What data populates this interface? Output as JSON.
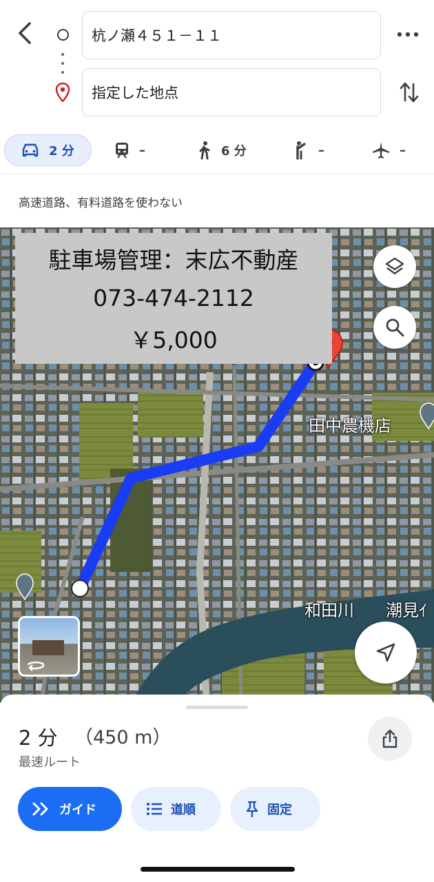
{
  "search": {
    "origin": "杭ノ瀬４５１－１１",
    "destination": "指定した地点"
  },
  "icons": {
    "back": "arrow-back-icon",
    "origin": "origin-circle-icon",
    "destination": "location-pin-icon",
    "more": "more-horizontal-icon",
    "swap": "swap-vertical-icon",
    "car": "car-icon",
    "transit": "train-icon",
    "walk": "walk-icon",
    "ride": "ride-hail-icon",
    "flight": "airplane-icon",
    "layers": "layers-icon",
    "search": "search-icon",
    "locate": "navigation-arrow-icon",
    "share": "share-icon",
    "guide": "double-chevron-icon",
    "steps": "list-icon",
    "pin": "pushpin-icon"
  },
  "modes": {
    "drive": "2 分",
    "transit": "–",
    "walk": "6 分",
    "ride": "–",
    "flight": "–"
  },
  "route_options_note": "高速道路、有料道路を使わない",
  "map": {
    "overlay": {
      "line1": "駐車場管理：末広不動産",
      "line2": "073-474-2112",
      "line3": "￥5,000"
    },
    "labels": {
      "shop": "田中農機店",
      "river": "和田川",
      "place": "潮見ｲ"
    }
  },
  "sheet": {
    "duration": "2 分",
    "distance": "（450 m）",
    "route_type": "最速ルート",
    "guide": "ガイド",
    "steps": "道順",
    "pin": "固定"
  },
  "colors": {
    "route": "#1a3cf5",
    "accent": "#1b6ef3",
    "pin": "#d93025"
  }
}
